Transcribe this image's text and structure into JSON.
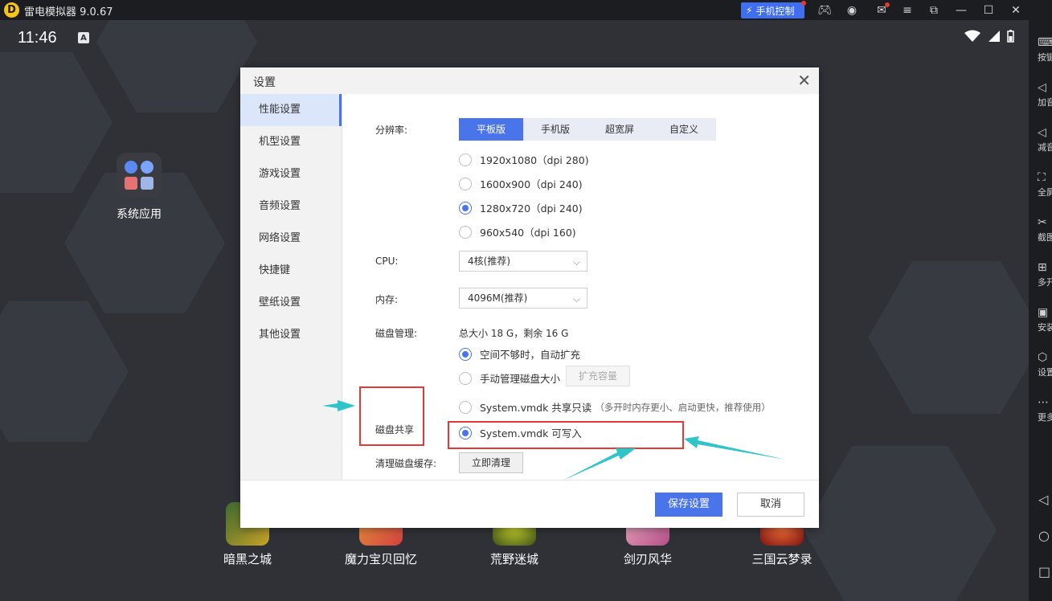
{
  "window": {
    "title": "雷电模拟器 9.0.67",
    "phone_control": "手机控制",
    "icons": [
      "gamepad-icon",
      "user-icon",
      "mail-icon",
      "menu-icon",
      "popout-icon",
      "minimize-icon",
      "maximize-icon",
      "close-icon"
    ]
  },
  "status": {
    "time": "11:46",
    "notif_letter": "A"
  },
  "desktop": {
    "system_app_label": "系统应用",
    "games": [
      "暗黑之城",
      "魔力宝贝回忆",
      "荒野迷城",
      "剑刃风华",
      "三国云梦录"
    ]
  },
  "rightbar": {
    "items": [
      "按键",
      "加音",
      "减音",
      "全屏",
      "截图",
      "多开",
      "安装",
      "设置",
      "更多"
    ]
  },
  "dialog": {
    "title": "设置",
    "nav": [
      "性能设置",
      "机型设置",
      "游戏设置",
      "音频设置",
      "网络设置",
      "快捷键",
      "壁纸设置",
      "其他设置"
    ],
    "active_nav": "性能设置",
    "resolution": {
      "label": "分辨率:",
      "tabs": [
        "平板版",
        "手机版",
        "超宽屏",
        "自定义"
      ],
      "active_tab": "平板版",
      "options": [
        "1920x1080（dpi 280)",
        "1600x900（dpi 240)",
        "1280x720（dpi 240)",
        "960x540（dpi 160)"
      ],
      "selected": "1280x720（dpi 240)"
    },
    "cpu": {
      "label": "CPU:",
      "value": "4核(推荐)"
    },
    "memory": {
      "label": "内存:",
      "value": "4096M(推荐)"
    },
    "disk": {
      "label": "磁盘管理:",
      "summary": "总大小 18 G，剩余 16 G",
      "auto_expand": "空间不够时，自动扩充",
      "manual": "手动管理磁盘大小",
      "expand_button": "扩充容量"
    },
    "disk_share": {
      "label": "磁盘共享",
      "readonly": "System.vmdk 共享只读",
      "readonly_note": "（多开时内存更小、启动更快，推荐使用）",
      "writable": "System.vmdk 可写入",
      "selected": "writable"
    },
    "cache": {
      "label": "清理磁盘缓存:",
      "button": "立即清理"
    },
    "save": "保存设置",
    "cancel": "取消"
  },
  "annotation_color": "#e53935",
  "arrow_color": "#2ec4c8",
  "accent": "#4a74ea"
}
